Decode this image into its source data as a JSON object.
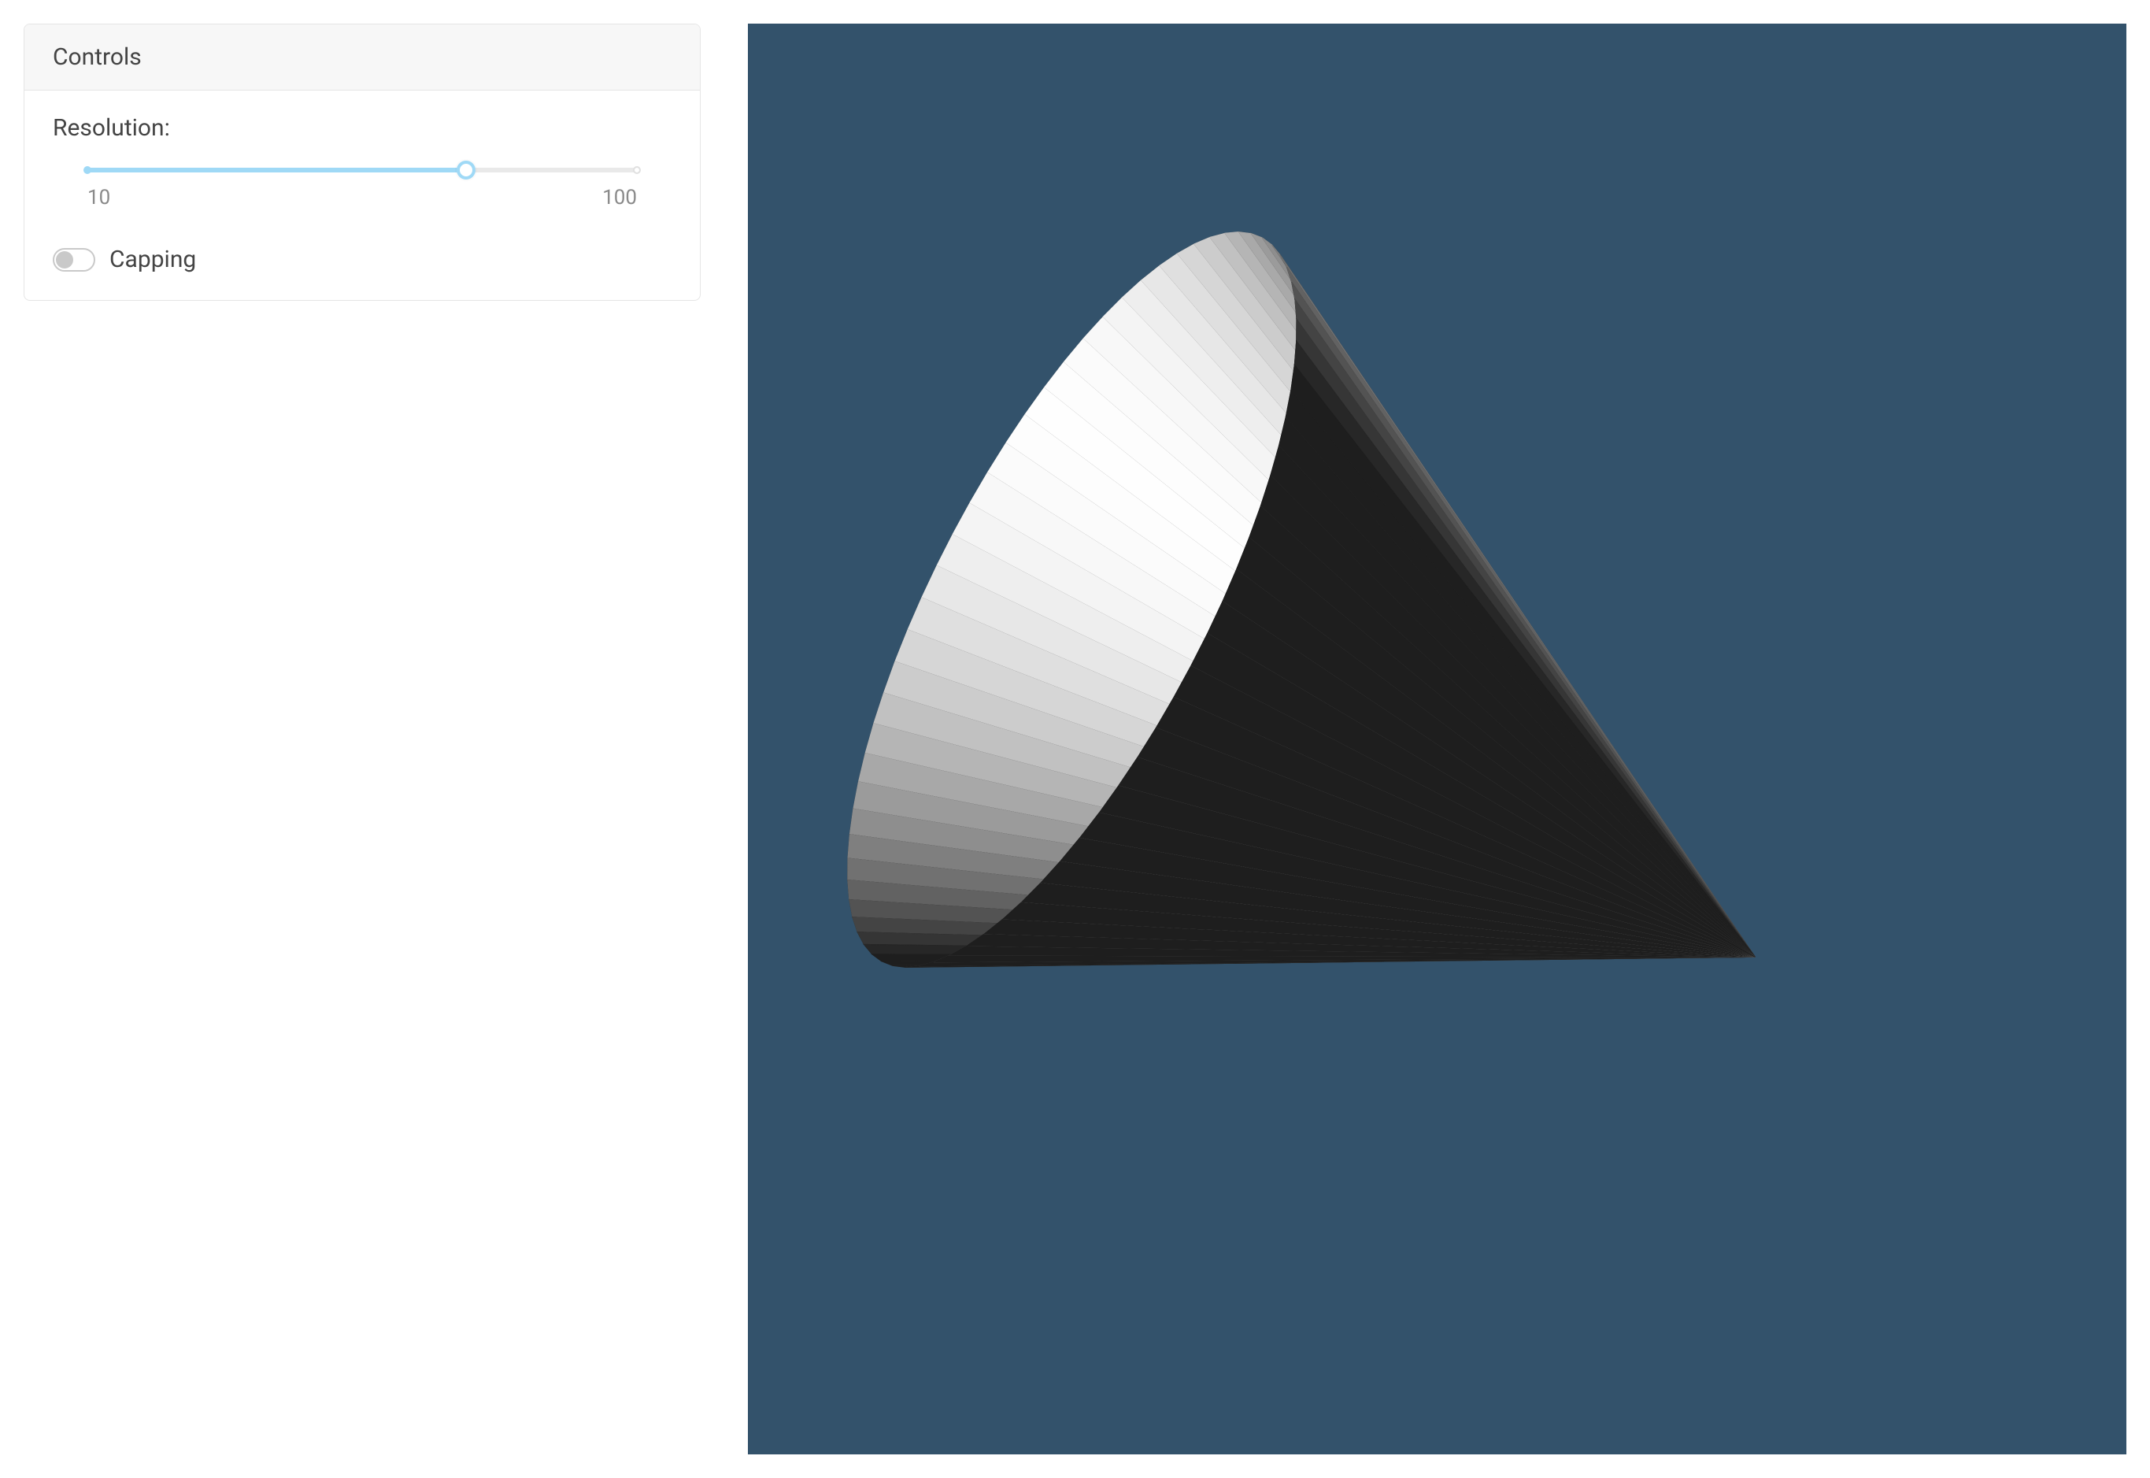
{
  "controls": {
    "header": "Controls",
    "resolution": {
      "label": "Resolution:",
      "min": 10,
      "max": 100,
      "value": 72,
      "min_label": "10",
      "max_label": "100"
    },
    "capping": {
      "label": "Capping",
      "enabled": false
    }
  },
  "viewport": {
    "background_color": "#33526b",
    "geometry": "cone",
    "resolution": 72,
    "capped": false
  }
}
